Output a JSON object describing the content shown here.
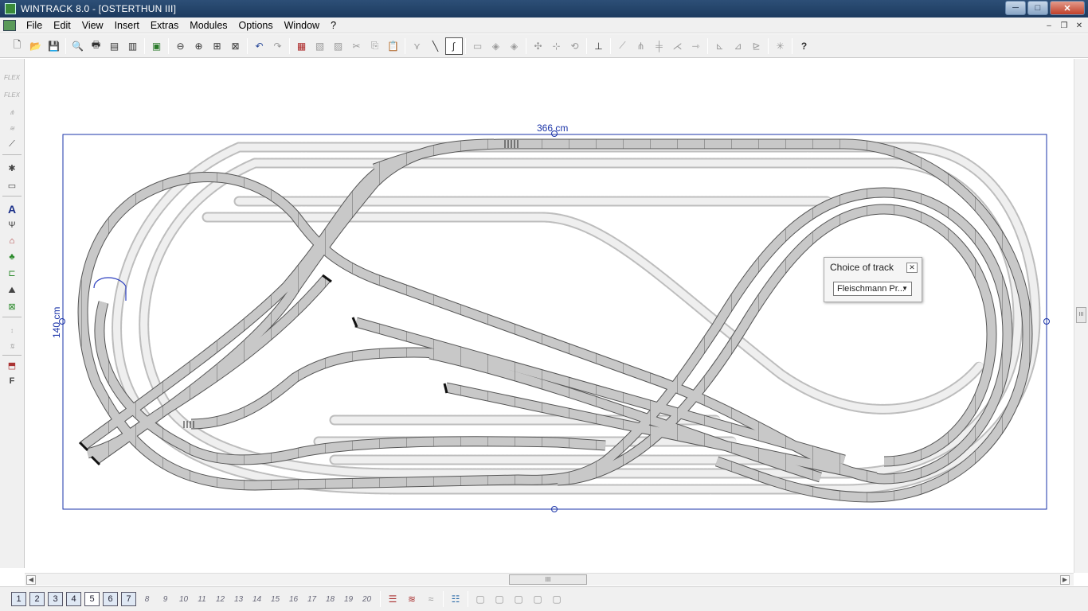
{
  "window": {
    "title": "WINTRACK 8.0 - [OSTERTHUN III]",
    "buttons": {
      "minimize": "─",
      "maximize": "□",
      "close": "✕"
    }
  },
  "menu": {
    "items": [
      "File",
      "Edit",
      "View",
      "Insert",
      "Extras",
      "Modules",
      "Options",
      "Window",
      "?"
    ],
    "mdi": {
      "minimize": "–",
      "restore": "❐",
      "close": "✕"
    }
  },
  "toolbar": {
    "icons": [
      "new-icon",
      "open-icon",
      "save-icon",
      "print-preview-icon",
      "print-icon",
      "printer-setup-icon",
      "page-setup-icon",
      "picture-icon",
      "zoom-out-icon",
      "zoom-in-icon",
      "zoom-window-icon",
      "zoom-all-icon",
      "undo-icon",
      "redo-icon",
      "parts-list-icon",
      "copy-doc-icon",
      "paste-doc-icon",
      "cut-icon",
      "copy-icon",
      "paste-icon",
      "track-connect-icon",
      "track-curve-icon",
      "flex-track-icon",
      "group-icon",
      "move-icon",
      "duplicate-icon",
      "rotate-icon",
      "align-icon",
      "rotate-180-icon",
      "new-section-icon",
      "turnout-icon",
      "turnout-branch-icon",
      "split-icon",
      "cross-icon",
      "extend-icon",
      "measure-icon",
      "elevation-icon",
      "gradient-icon",
      "snap-icon",
      "help-icon"
    ]
  },
  "left_tools": {
    "flex_label": "FLEX"
  },
  "canvas": {
    "width_label": "366 cm",
    "height_label": "140 cm"
  },
  "choice_panel": {
    "title": "Choice of track",
    "selected": "Fleischmann Pr..."
  },
  "layers": {
    "boxed": [
      "1",
      "2",
      "3",
      "4",
      "5",
      "6",
      "7"
    ],
    "plain": [
      "8",
      "9",
      "10",
      "11",
      "12",
      "13",
      "14",
      "15",
      "16",
      "17",
      "18",
      "19",
      "20"
    ]
  },
  "scroll": {
    "thumb": "III"
  },
  "colors": {
    "track_fill": "#c8c8c8",
    "track_edge": "#555555",
    "hidden_track": "#e6e6e6",
    "border_blue": "#1a33a8"
  }
}
